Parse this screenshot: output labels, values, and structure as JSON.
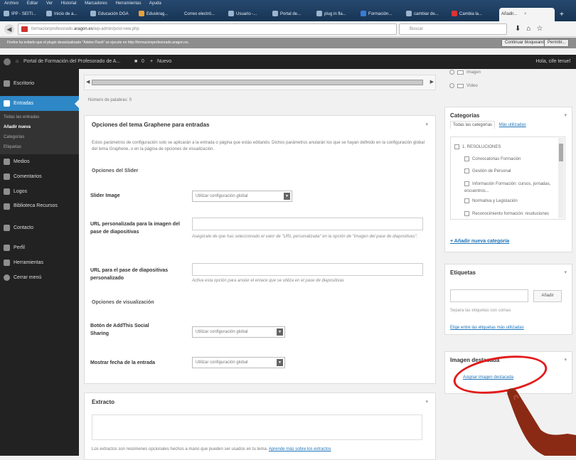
{
  "browser": {
    "menu": [
      "Archivo",
      "Editar",
      "Ver",
      "Historial",
      "Marcadores",
      "Herramientas",
      "Ayuda"
    ],
    "tabs": [
      {
        "label": "IPP - SEITI..."
      },
      {
        "label": "Inicio de a..."
      },
      {
        "label": "Educación DGA"
      },
      {
        "label": "Eduskrag..."
      },
      {
        "label": "Correo electró..."
      },
      {
        "label": "Usuario -..."
      },
      {
        "label": "Portal de..."
      },
      {
        "label": "plug in fla..."
      },
      {
        "label": "Formación..."
      },
      {
        "label": "cambiar de..."
      },
      {
        "label": "Cambia la..."
      },
      {
        "label": "Añadir..."
      }
    ],
    "url_prefix": "formacionprofesorado.",
    "url_domain": "aragon.es",
    "url_suffix": "/wp-admin/post-new.php",
    "search_placeholder": "Buscar",
    "notification": "Firefox ha evitado que el plugin desactualizado \"Adobe Flash\" se ejecute en http://formacionprofesorado.aragon.es.",
    "continue_label": "Continuar bloqueando",
    "allow_label": "Permitir..."
  },
  "adminbar": {
    "site": "Portal de Formación del Profesorado de A...",
    "comments": "0",
    "new_label": "Nuevo",
    "greeting": "Hola, cife teruel"
  },
  "sidebar": {
    "items": [
      {
        "label": "Escritorio"
      },
      {
        "label": "Entradas"
      },
      {
        "label": "Medios"
      },
      {
        "label": "Comentarios"
      },
      {
        "label": "Logos"
      },
      {
        "label": "Biblioteca Recursos"
      },
      {
        "label": "Contacto"
      },
      {
        "label": "Perfil"
      },
      {
        "label": "Herramientas"
      },
      {
        "label": "Cerrar menú"
      }
    ],
    "sub": [
      {
        "label": "Todas las entradas"
      },
      {
        "label": "Añadir nueva"
      },
      {
        "label": "Categorías"
      },
      {
        "label": "Etiquetas"
      }
    ]
  },
  "editor": {
    "word_count": "Número de palabras: 0"
  },
  "graphene": {
    "title": "Opciones del tema Graphene para entradas",
    "description": "Estos parámetros de configuración solo se aplicarán a la entrada o página que estás editando. Dichos parámetros anularán los que se hayan definido en la configuración global del tema Graphene, o en la página de opciones de visualización.",
    "slider_section": "Opciones del Slider",
    "slider_image_label": "Slider Image",
    "global_option": "Utilizar configuración global",
    "custom_url_label": "URL personalizada para la imagen del pase de diapositivas",
    "custom_url_hint": "Asegúrate de que has seleccionado el valor de \"URL personalizada\" en la opción de \"Imagen del pase de diapositivas\".",
    "custom_link_label": "URL para el pase de diapositivas personalizado",
    "custom_link_hint": "Activa esta opción para anular el enlace que se utiliza en el pase de diapositivas",
    "display_section": "Opciones de visualización",
    "addthis_label": "Botón de AddThis Social Sharing",
    "date_label": "Mostrar fecha de la entrada"
  },
  "excerpt": {
    "title": "Extracto",
    "help": "Los extractos son resúmenes opcionales hechos a mano que pueden ser usados en tu tema.",
    "help_link": "Aprende más sobre los extractos"
  },
  "format": {
    "options": [
      "Imagen",
      "Vídeo"
    ]
  },
  "categories": {
    "title": "Categorías",
    "tab_all": "Todas las categorías",
    "tab_popular": "Más utilizadas",
    "items": [
      "1. RESOLUCIONES",
      "Convocatorias Formación",
      "Gestión de Personal",
      "Información Formación: cursos, jornadas, encuentros...",
      "Normativa y Legislación",
      "Reconocimiento formación: resoluciones"
    ],
    "add_link": "+ Añadir nueva categoría"
  },
  "tags": {
    "title": "Etiquetas",
    "add_button": "Añadir",
    "hint": "Separa las etiquetas con comas",
    "choose_link": "Elige entre las etiquetas más utilizadas"
  },
  "featured": {
    "title": "Imagen destacada",
    "link": "Asignar imagen destacada"
  },
  "colors": {
    "admin_bar": "#222222",
    "sidebar": "#222222",
    "accent": "#2e87c6",
    "annotation": "#e21b1b",
    "arrow": "#8b2a14"
  }
}
